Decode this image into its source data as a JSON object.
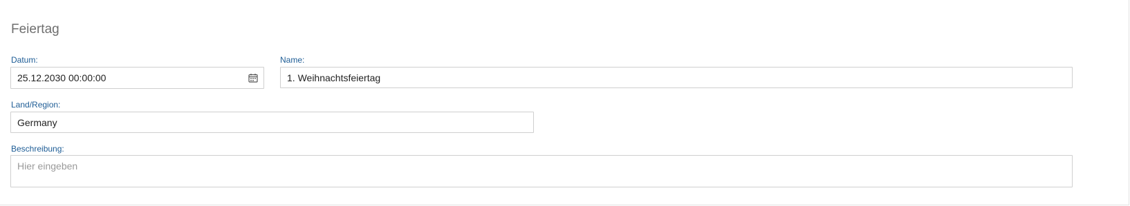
{
  "form": {
    "title": "Feiertag",
    "datum": {
      "label": "Datum:",
      "value": "25.12.2030 00:00:00",
      "icon": "calendar-icon"
    },
    "name": {
      "label": "Name:",
      "value": "1. Weihnachtsfeiertag"
    },
    "region": {
      "label": "Land/Region:",
      "value": "Germany"
    },
    "beschreibung": {
      "label": "Beschreibung:",
      "value": "",
      "placeholder": "Hier eingeben"
    }
  },
  "colors": {
    "label": "#1d5c95",
    "title": "#6f6f6f",
    "border": "#cfcfcf"
  }
}
